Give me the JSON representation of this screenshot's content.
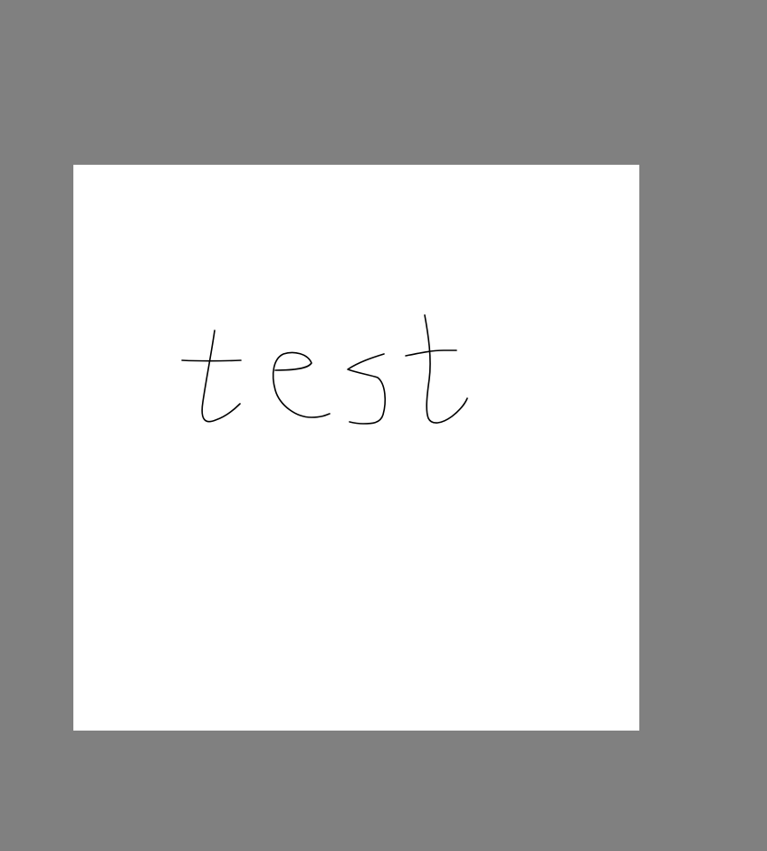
{
  "workspace": {
    "background_color": "#808080"
  },
  "canvas": {
    "background_color": "#ffffff",
    "ink_color": "#000000",
    "handwritten_text": "test"
  }
}
